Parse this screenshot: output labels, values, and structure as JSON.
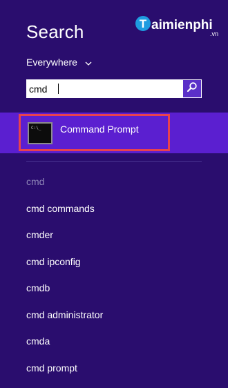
{
  "header": {
    "title": "Search",
    "watermark": {
      "first_letter": "T",
      "rest": "aimienphi",
      "suffix": ".vn"
    }
  },
  "scope": {
    "label": "Everywhere",
    "icon": "chevron-down-icon"
  },
  "search": {
    "value": "cmd",
    "placeholder": "",
    "button_icon": "magnifier-icon"
  },
  "results": [
    {
      "label": "Command Prompt",
      "icon": "command-prompt-icon",
      "icon_text": "C:\\_"
    }
  ],
  "suggestions": [
    {
      "label": "cmd"
    },
    {
      "label": "cmd commands"
    },
    {
      "label": "cmder"
    },
    {
      "label": "cmd ipconfig"
    },
    {
      "label": "cmdb"
    },
    {
      "label": "cmd administrator"
    },
    {
      "label": "cmda"
    },
    {
      "label": "cmd prompt"
    }
  ],
  "colors": {
    "background": "#2a0d6e",
    "highlight": "#5b1fd0",
    "selection_border": "#e8424e",
    "search_button": "#5b30c8",
    "suggestion_dim": "#8f86b8"
  }
}
